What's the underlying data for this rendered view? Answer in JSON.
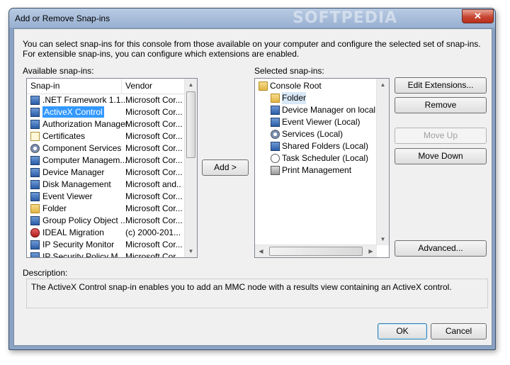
{
  "window": {
    "title": "Add or Remove Snap-ins",
    "watermark": "SOFTPEDIA",
    "close_glyph": "✕"
  },
  "intro": "You can select snap-ins for this console from those available on your computer and configure the selected set of snap-ins. For extensible snap-ins, you can configure which extensions are enabled.",
  "available": {
    "label": "Available snap-ins:",
    "col_snapin": "Snap-in",
    "col_vendor": "Vendor",
    "items": [
      {
        "name": ".NET Framework 1.1...",
        "vendor": "Microsoft Cor...",
        "icon": "dotnet-icon"
      },
      {
        "name": "ActiveX Control",
        "vendor": "Microsoft Cor...",
        "icon": "activex-icon"
      },
      {
        "name": "Authorization Manager",
        "vendor": "Microsoft Cor...",
        "icon": "authorization-icon"
      },
      {
        "name": "Certificates",
        "vendor": "Microsoft Cor...",
        "icon": "certificate-icon"
      },
      {
        "name": "Component Services",
        "vendor": "Microsoft Cor...",
        "icon": "component-services-icon"
      },
      {
        "name": "Computer Managem...",
        "vendor": "Microsoft Cor...",
        "icon": "computer-management-icon"
      },
      {
        "name": "Device Manager",
        "vendor": "Microsoft Cor...",
        "icon": "device-manager-icon"
      },
      {
        "name": "Disk Management",
        "vendor": "Microsoft and...",
        "icon": "disk-management-icon"
      },
      {
        "name": "Event Viewer",
        "vendor": "Microsoft Cor...",
        "icon": "event-viewer-icon"
      },
      {
        "name": "Folder",
        "vendor": "Microsoft Cor...",
        "icon": "folder-icon"
      },
      {
        "name": "Group Policy Object ...",
        "vendor": "Microsoft Cor...",
        "icon": "group-policy-icon"
      },
      {
        "name": "IDEAL Migration",
        "vendor": "(c) 2000-201...",
        "icon": "ideal-migration-icon"
      },
      {
        "name": "IP Security Monitor",
        "vendor": "Microsoft Cor...",
        "icon": "ip-security-icon"
      },
      {
        "name": "IP Security Policy M...",
        "vendor": "Microsoft Cor...",
        "icon": "ip-security-policy-icon"
      }
    ]
  },
  "add_button": "Add >",
  "selected": {
    "label": "Selected snap-ins:",
    "root": "Console Root",
    "items": [
      {
        "name": "Folder",
        "icon": "folder-icon"
      },
      {
        "name": "Device Manager on local computer",
        "icon": "device-manager-icon"
      },
      {
        "name": "Event Viewer (Local)",
        "icon": "event-viewer-icon"
      },
      {
        "name": "Services (Local)",
        "icon": "services-icon"
      },
      {
        "name": "Shared Folders (Local)",
        "icon": "shared-folders-icon"
      },
      {
        "name": "Task Scheduler (Local)",
        "icon": "task-scheduler-icon"
      },
      {
        "name": "Print Management",
        "icon": "print-management-icon"
      }
    ]
  },
  "buttons": {
    "edit_extensions": "Edit Extensions...",
    "remove": "Remove",
    "move_up": "Move Up",
    "move_down": "Move Down",
    "advanced": "Advanced...",
    "ok": "OK",
    "cancel": "Cancel"
  },
  "description": {
    "label": "Description:",
    "text": "The ActiveX Control snap-in enables you to add an MMC node with a results view containing an ActiveX control."
  },
  "colors": {
    "selection": "#3399ff",
    "frame": "#8aa3c4"
  }
}
